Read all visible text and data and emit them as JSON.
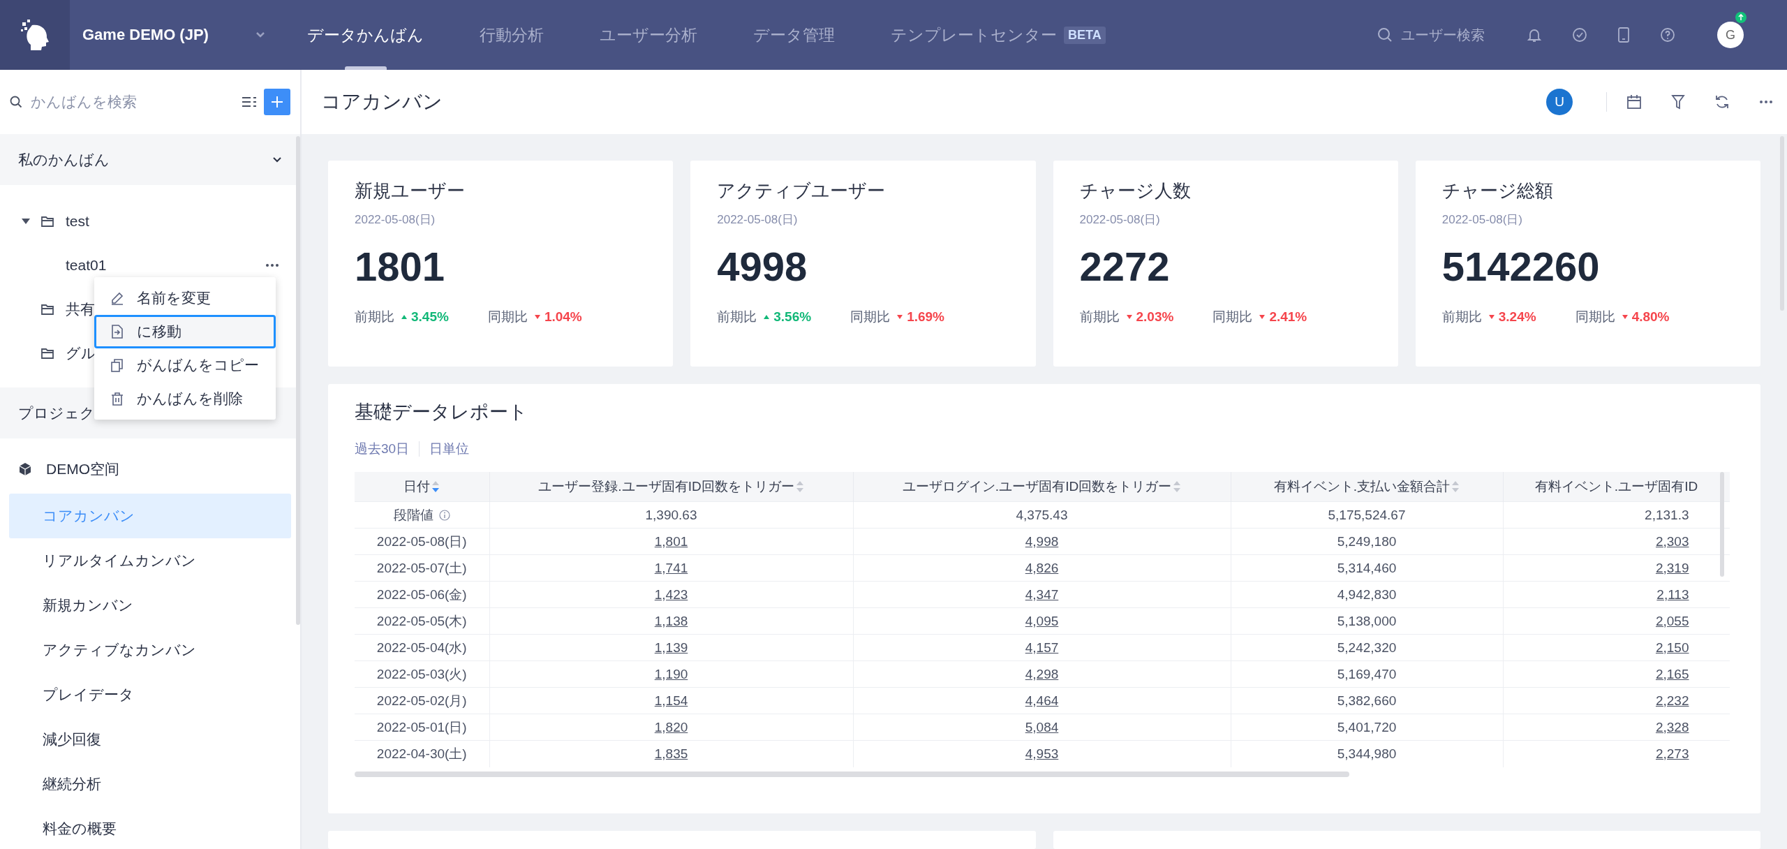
{
  "top_bar": {
    "project": "Game DEMO (JP)",
    "tabs": [
      {
        "label": "データかんばん",
        "selected": true
      },
      {
        "label": "行動分析",
        "selected": false
      },
      {
        "label": "ユーザー分析",
        "selected": false
      },
      {
        "label": "データ管理",
        "selected": false
      },
      {
        "label": "テンプレートセンター",
        "selected": false,
        "badge": "BETA"
      }
    ],
    "search": {
      "placeholder": "ユーザー検索"
    },
    "avatar": {
      "initial": "G",
      "update_badge": true
    }
  },
  "sidebar": {
    "search": {
      "placeholder": "かんばんを検索"
    },
    "my_boards": {
      "title": "私のかんばん",
      "expanded": true,
      "tree": [
        {
          "label": "test",
          "expanded": true,
          "children": [
            {
              "label": "teat01",
              "hovered": true
            }
          ]
        },
        {
          "label": "共有",
          "expanded": false
        },
        {
          "label": "グル",
          "expanded": false
        }
      ]
    },
    "projects": {
      "title": "プロジェク",
      "space": "DEMO空间",
      "items": [
        {
          "label": "コアカンバン",
          "selected": true
        },
        {
          "label": "リアルタイムカンバン",
          "selected": false
        },
        {
          "label": "新規カンバン",
          "selected": false
        },
        {
          "label": "アクティブなカンバン",
          "selected": false
        },
        {
          "label": "プレイデータ",
          "selected": false
        },
        {
          "label": "減少回復",
          "selected": false
        },
        {
          "label": "継続分析",
          "selected": false
        },
        {
          "label": "料金の概要",
          "selected": false
        }
      ]
    },
    "context_menu": [
      {
        "kind": "rename",
        "label": "名前を変更",
        "selected": false
      },
      {
        "kind": "move",
        "label": "に移動",
        "selected": true
      },
      {
        "kind": "copy",
        "label": "がんばんをコピー",
        "selected": false
      },
      {
        "kind": "delete",
        "label": "かんばんを削除",
        "selected": false
      }
    ]
  },
  "main": {
    "title": "コアカンバン",
    "avatar": "U",
    "cards": [
      {
        "title": "新規ユーザー",
        "date": "2022-05-08(日)",
        "value": "1801",
        "deltas": [
          {
            "label": "前期比",
            "rising": true,
            "value": "3.45%"
          },
          {
            "label": "同期比",
            "rising": false,
            "value": "1.04%"
          }
        ]
      },
      {
        "title": "アクティブユーザー",
        "date": "2022-05-08(日)",
        "value": "4998",
        "deltas": [
          {
            "label": "前期比",
            "rising": true,
            "value": "3.56%"
          },
          {
            "label": "同期比",
            "rising": false,
            "value": "1.69%"
          }
        ]
      },
      {
        "title": "チャージ人数",
        "date": "2022-05-08(日)",
        "value": "2272",
        "deltas": [
          {
            "label": "前期比",
            "rising": false,
            "value": "2.03%"
          },
          {
            "label": "同期比",
            "rising": false,
            "value": "2.41%"
          }
        ]
      },
      {
        "title": "チャージ総額",
        "date": "2022-05-08(日)",
        "value": "5142260",
        "deltas": [
          {
            "label": "前期比",
            "rising": false,
            "value": "3.24%"
          },
          {
            "label": "同期比",
            "rising": false,
            "value": "4.80%"
          }
        ]
      }
    ],
    "report": {
      "title": "基礎データレポート",
      "filters": [
        "過去30日",
        "日単位"
      ],
      "columns": [
        {
          "label": "日付",
          "sortable": true,
          "sorted": true,
          "linked": false
        },
        {
          "label": "ユーザー登録.ユーザ固有ID回数をトリガー",
          "sortable": true,
          "sorted": false,
          "linked": true
        },
        {
          "label": "ユーザログイン.ユーザ固有ID回数をトリガー",
          "sortable": true,
          "sorted": false,
          "linked": true
        },
        {
          "label": "有料イベント.支払い金額合計",
          "sortable": true,
          "sorted": false,
          "linked": false
        },
        {
          "label": "有料イベント.ユーザ固有ID",
          "linked": true
        }
      ],
      "rows": [
        {
          "kind": "baseline",
          "cells": [
            "段階値",
            "1,390.63",
            "4,375.43",
            "5,175,524.67",
            "2,131.3"
          ]
        },
        {
          "kind": "day",
          "cells": [
            "2022-05-08(日)",
            "1,801",
            "4,998",
            "5,249,180",
            "2,303"
          ]
        },
        {
          "kind": "day",
          "cells": [
            "2022-05-07(土)",
            "1,741",
            "4,826",
            "5,314,460",
            "2,319"
          ]
        },
        {
          "kind": "day",
          "cells": [
            "2022-05-06(金)",
            "1,423",
            "4,347",
            "4,942,830",
            "2,113"
          ]
        },
        {
          "kind": "day",
          "cells": [
            "2022-05-05(木)",
            "1,138",
            "4,095",
            "5,138,000",
            "2,055"
          ]
        },
        {
          "kind": "day",
          "cells": [
            "2022-05-04(水)",
            "1,139",
            "4,157",
            "5,242,320",
            "2,150"
          ]
        },
        {
          "kind": "day",
          "cells": [
            "2022-05-03(火)",
            "1,190",
            "4,298",
            "5,169,470",
            "2,165"
          ]
        },
        {
          "kind": "day",
          "cells": [
            "2022-05-02(月)",
            "1,154",
            "4,464",
            "5,382,660",
            "2,232"
          ]
        },
        {
          "kind": "day",
          "cells": [
            "2022-05-01(日)",
            "1,820",
            "5,084",
            "5,401,720",
            "2,328"
          ]
        },
        {
          "kind": "day",
          "cells": [
            "2022-04-30(土)",
            "1,835",
            "4,953",
            "5,344,980",
            "2,273"
          ]
        }
      ]
    }
  }
}
